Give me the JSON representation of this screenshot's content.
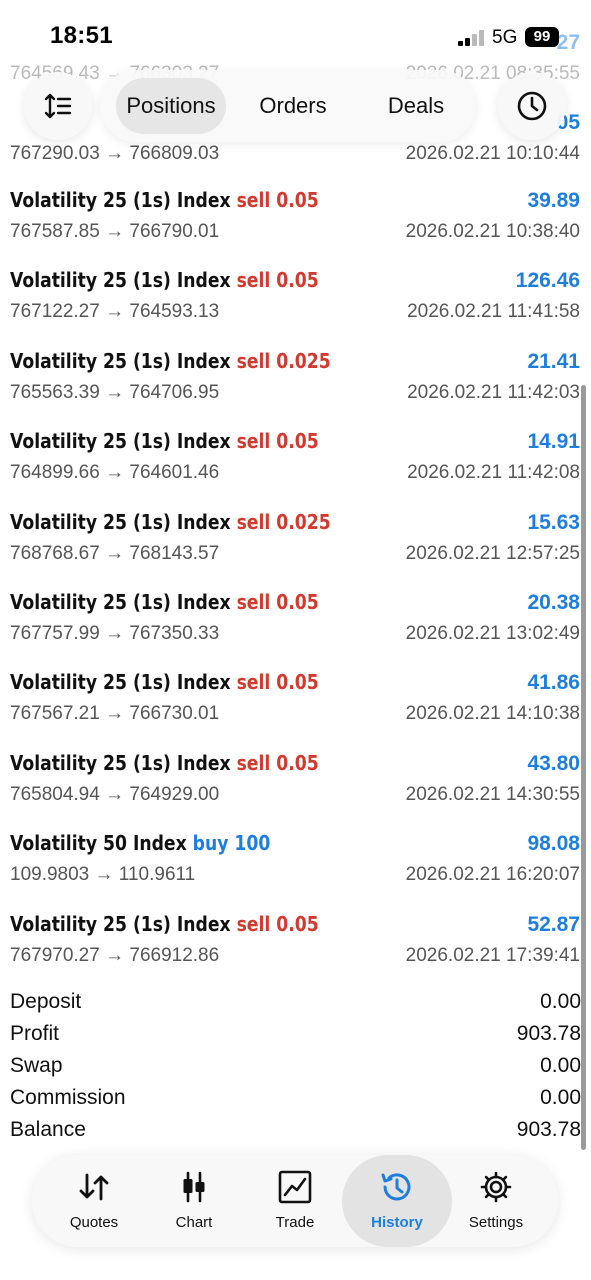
{
  "status_bar": {
    "time": "18:51",
    "network": "5G",
    "battery": "99"
  },
  "toolbar": {
    "tabs": [
      {
        "label": "Positions"
      },
      {
        "label": "Orders"
      },
      {
        "label": "Deals"
      }
    ]
  },
  "partial_rows": [
    {
      "prices": "764569.43 → 766303.27",
      "time": "2026.02.21 08:35:55",
      "profit": "27"
    },
    {
      "prices": "767290.03 → 766809.03",
      "time": "2026.02.21 10:10:44",
      "profit": "05"
    }
  ],
  "deals": [
    {
      "symbol": "Volatility 25 (1s) Index",
      "side": "sell",
      "volume": "0.05",
      "profit": "39.89",
      "prices": "767587.85 → 766790.01",
      "time": "2026.02.21 10:38:40"
    },
    {
      "symbol": "Volatility 25 (1s) Index",
      "side": "sell",
      "volume": "0.05",
      "profit": "126.46",
      "prices": "767122.27 → 764593.13",
      "time": "2026.02.21 11:41:58"
    },
    {
      "symbol": "Volatility 25 (1s) Index",
      "side": "sell",
      "volume": "0.025",
      "profit": "21.41",
      "prices": "765563.39 → 764706.95",
      "time": "2026.02.21 11:42:03"
    },
    {
      "symbol": "Volatility 25 (1s) Index",
      "side": "sell",
      "volume": "0.05",
      "profit": "14.91",
      "prices": "764899.66 → 764601.46",
      "time": "2026.02.21 11:42:08"
    },
    {
      "symbol": "Volatility 25 (1s) Index",
      "side": "sell",
      "volume": "0.025",
      "profit": "15.63",
      "prices": "768768.67 → 768143.57",
      "time": "2026.02.21 12:57:25"
    },
    {
      "symbol": "Volatility 25 (1s) Index",
      "side": "sell",
      "volume": "0.05",
      "profit": "20.38",
      "prices": "767757.99 → 767350.33",
      "time": "2026.02.21 13:02:49"
    },
    {
      "symbol": "Volatility 25 (1s) Index",
      "side": "sell",
      "volume": "0.05",
      "profit": "41.86",
      "prices": "767567.21 → 766730.01",
      "time": "2026.02.21 14:10:38"
    },
    {
      "symbol": "Volatility 25 (1s) Index",
      "side": "sell",
      "volume": "0.05",
      "profit": "43.80",
      "prices": "765804.94 → 764929.00",
      "time": "2026.02.21 14:30:55"
    },
    {
      "symbol": "Volatility 50 Index",
      "side": "buy",
      "volume": "100",
      "profit": "98.08",
      "prices": "109.9803 → 110.9611",
      "time": "2026.02.21 16:20:07"
    },
    {
      "symbol": "Volatility 25 (1s) Index",
      "side": "sell",
      "volume": "0.05",
      "profit": "52.87",
      "prices": "767970.27 → 766912.86",
      "time": "2026.02.21 17:39:41"
    }
  ],
  "summary": [
    {
      "label": "Deposit",
      "value": "0.00"
    },
    {
      "label": "Profit",
      "value": "903.78"
    },
    {
      "label": "Swap",
      "value": "0.00"
    },
    {
      "label": "Commission",
      "value": "0.00"
    },
    {
      "label": "Balance",
      "value": "903.78"
    }
  ],
  "bottom_nav": [
    {
      "label": "Quotes",
      "icon": "quotes-arrows-icon"
    },
    {
      "label": "Chart",
      "icon": "candlestick-icon"
    },
    {
      "label": "Trade",
      "icon": "trade-chart-icon"
    },
    {
      "label": "History",
      "icon": "history-clock-icon",
      "active": true
    },
    {
      "label": "Settings",
      "icon": "gear-icon"
    }
  ],
  "colors": {
    "sell": "#d33a2f",
    "buy": "#1e7ee0",
    "profit": "#1e7ee0",
    "active_tab": "#1e7ee0"
  }
}
